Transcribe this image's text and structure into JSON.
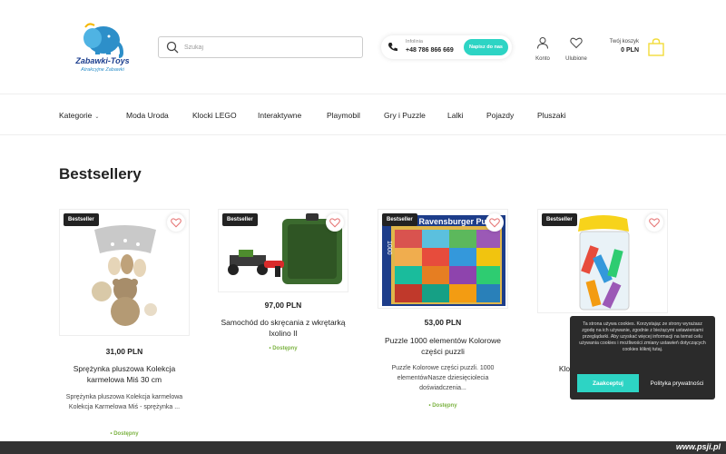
{
  "header": {
    "logo": {
      "name": "Zabawki-Toys",
      "tagline": "Atrakcyjne Zabawki"
    },
    "search": {
      "placeholder": "Szukaj",
      "value": ""
    },
    "hotline": {
      "label": "Infolinia",
      "number": "+48 786 866 669",
      "button": "Napisz do nas"
    },
    "account": {
      "label": "Konto"
    },
    "favorites": {
      "label": "Ulubione"
    },
    "cart": {
      "label": "Twój koszyk",
      "total": "0 PLN"
    }
  },
  "nav": {
    "items": [
      "Kategorie",
      "Moda Uroda",
      "Klocki LEGO",
      "Interaktywne",
      "Playmobil",
      "Gry i Puzzle",
      "Lalki",
      "Pojazdy",
      "Pluszaki"
    ]
  },
  "section": {
    "title": "Bestsellery"
  },
  "products": [
    {
      "badge": "Bestseller",
      "price": "31,00 PLN",
      "name": "Sprężynka pluszowa Kolekcja karmelowa Miś 30 cm",
      "desc": "Sprężynka pluszowa Kolekcja karmelowa Kolekcja Karmelowa Miś - sprężynka ...",
      "availability": "• Dostępny"
    },
    {
      "badge": "Bestseller",
      "price": "97,00 PLN",
      "name": "Samochód do skręcania z wkrętarką Ixolino II",
      "desc": "",
      "availability": "• Dostępny"
    },
    {
      "badge": "Bestseller",
      "price": "53,00 PLN",
      "name": "Puzzle 1000 elementów Kolorowe części puzzli",
      "desc": "Puzzle Kolorowe części puzzli. 1000 elementówNasze dziesięciolecia doświadczenia...",
      "availability": "• Dostępny",
      "box_brand": "Ravensburger Puzzle",
      "box_count": "1000"
    },
    {
      "badge": "Bestseller",
      "price": "",
      "name": "Klocki Maflaty Mini Waffle",
      "desc": "",
      "availability": ""
    }
  ],
  "cookie": {
    "text": "Ta strona używa cookies. Korzystając ze strony wyrażasz zgodę na ich używanie, zgodnie z bieżącymi ustawieniami przeglądarki. Aby uzyskać więcej informacji na temat celu używania cookies i możliwości zmiany ustawień dotyczących cookies kliknij tutaj.",
    "accept": "Zaakceptuj",
    "privacy": "Polityka prywatności"
  },
  "watermark": "www.psji.pl",
  "colors": {
    "accent": "#2dd4c4",
    "available": "#7cb342",
    "badge": "#222222",
    "heart": "#e57373"
  }
}
